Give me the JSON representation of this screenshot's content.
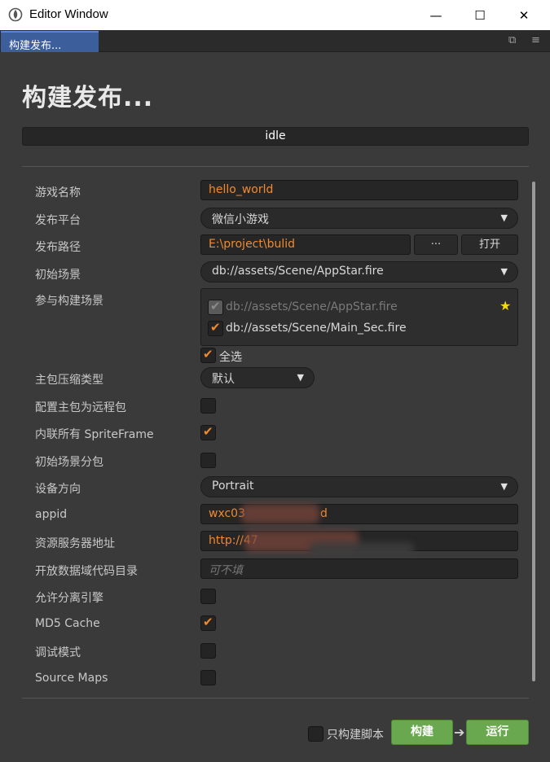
{
  "window": {
    "title": "Editor Window",
    "min_glyph": "—",
    "max_glyph": "☐",
    "close_glyph": "✕"
  },
  "tab": {
    "label": "构建发布..."
  },
  "page": {
    "heading": "构建发布...",
    "status": "idle"
  },
  "labels": {
    "game_name": "游戏名称",
    "platform": "发布平台",
    "build_path": "发布路径",
    "start_scene": "初始场景",
    "included_scenes": "参与构建场景",
    "compression": "主包压缩类型",
    "remote_main": "配置主包为远程包",
    "inline_spriteframe": "内联所有 SpriteFrame",
    "subpackage_start": "初始场景分包",
    "orientation": "设备方向",
    "appid": "appid",
    "res_server": "资源服务器地址",
    "open_data": "开放数据域代码目录",
    "separate_engine": "允许分离引擎",
    "md5": "MD5 Cache",
    "debug": "调试模式",
    "source_maps": "Source Maps"
  },
  "values": {
    "game_name": "hello_world",
    "platform": "微信小游戏",
    "build_path": "E:\\project\\bulid",
    "browse_button": "···",
    "open_button": "打开",
    "start_scene": "db://assets/Scene/AppStar.fire",
    "scenes": [
      {
        "path": "db://assets/Scene/AppStar.fire",
        "checked": true,
        "disabled": true
      },
      {
        "path": "db://assets/Scene/Main_Sec.fire",
        "checked": true,
        "disabled": false
      }
    ],
    "select_all": "全选",
    "compression": "默认",
    "orientation": "Portrait",
    "appid_prefix": "wxc03",
    "appid_suffix": "d",
    "res_server": "http://47",
    "open_data_placeholder": "可不填"
  },
  "checks": {
    "remote_main": false,
    "inline_spriteframe": true,
    "subpackage_start": false,
    "separate_engine": false,
    "md5": true,
    "debug": false,
    "source_maps": false,
    "select_all": true,
    "build_script_only": false
  },
  "footer": {
    "build_script_only": "只构建脚本",
    "build": "构建",
    "run": "运行"
  },
  "colors": {
    "accent": "#f08a30",
    "tab_active": "#3c5e9b",
    "action_green": "#6aa84f",
    "background": "#3a3a3a"
  }
}
